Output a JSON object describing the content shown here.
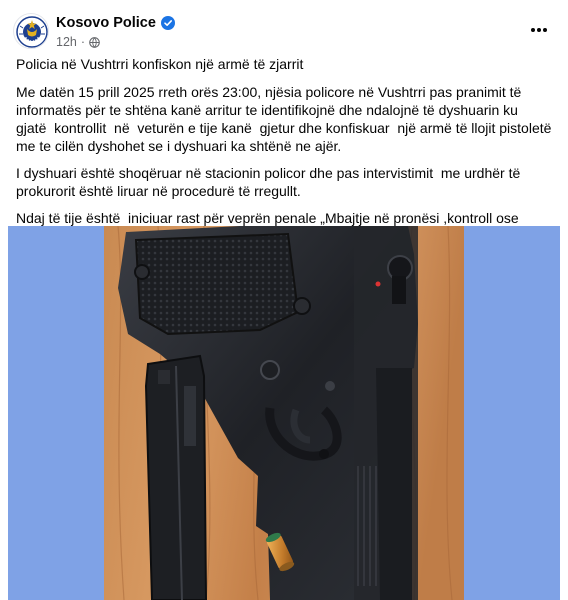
{
  "post": {
    "author": "Kosovo Police",
    "verified": true,
    "timestamp": "12h",
    "audience_icon": "globe-icon",
    "more_icon": "more-options-icon",
    "paragraphs": [
      "Policia në Vushtrri konfiskon një armë të zjarrit",
      "Me datën 15 prill 2025 rreth orës 23:00, njësia policore në Vushtrri pas pranimit të informatës për te shtëna kanë arritur te identifikojnë dhe ndalojnë të dyshuarin ku   gjatë  kontrollit  në  veturën e tije kanë  gjetur dhe konfiskuar  një armë të llojit pistoletë me te cilën dyshohet se i dyshuari ka shtënë ne ajër.",
      "I dyshuari është shoqëruar në stacionin policor dhe pas intervistimit  me urdhër të prokurorit është liruar në procedurë të rregullt.",
      "Ndaj të tije është  iniciuar rast për veprën penale „Mbajtje në pronësi ,kontroll ose posedim të paautorizuar të armëve\" dhe \"Përdorim i armës\"."
    ],
    "photo": {
      "subject": "pistol-magazine-cartridge-on-wood",
      "background_color": "#7fa2e6"
    }
  },
  "colors": {
    "verified": "#1b74e4",
    "secondary_text": "#65676b",
    "logo_blue": "#1d3f8f",
    "logo_gold": "#e2b021"
  }
}
